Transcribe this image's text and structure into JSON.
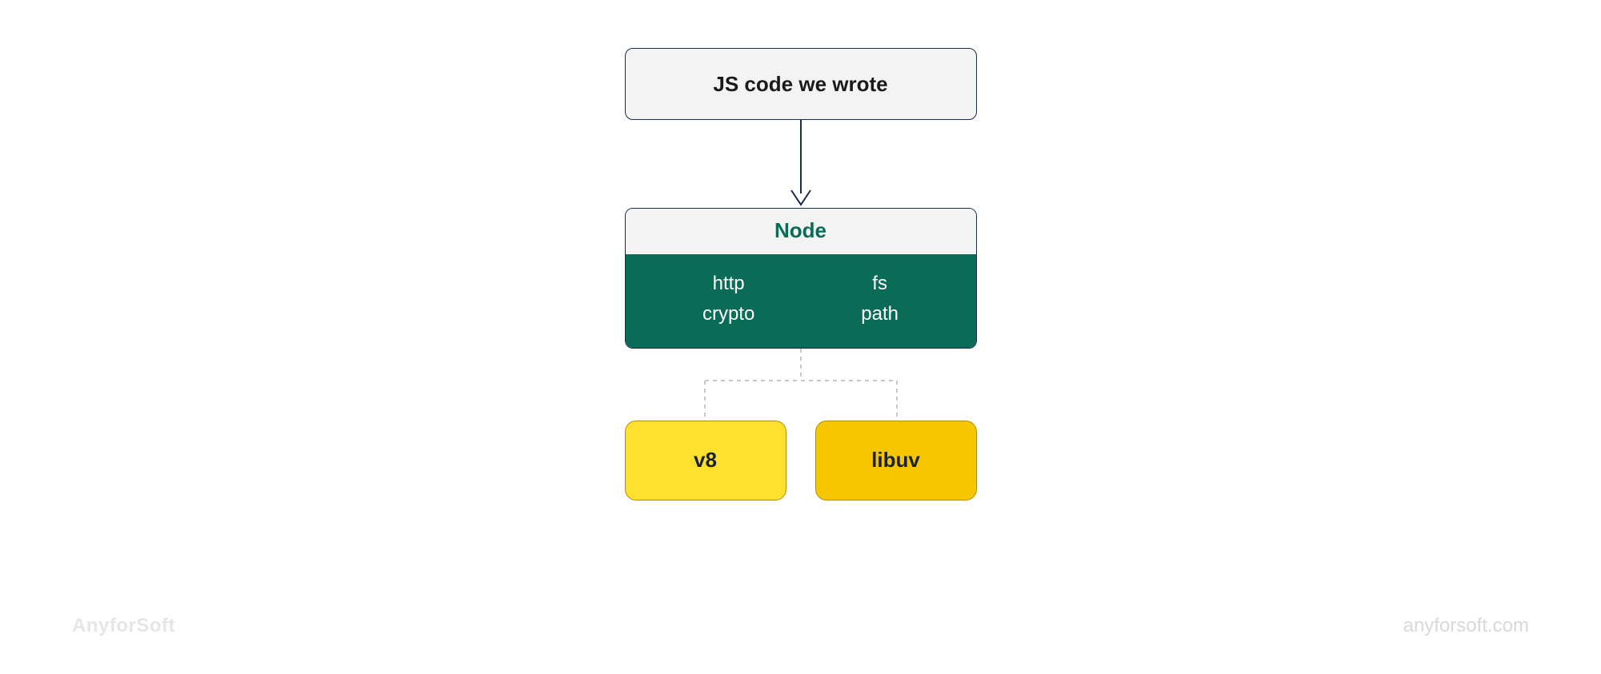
{
  "diagram": {
    "top_box": "JS code we wrote",
    "node_header": "Node",
    "node_modules_col1": [
      "http",
      "crypto"
    ],
    "node_modules_col2": [
      "fs",
      "path"
    ],
    "deps": {
      "left": "v8",
      "right": "libuv"
    }
  },
  "footer": {
    "left": "AnyforSoft",
    "right": "anyforsoft.com"
  },
  "colors": {
    "box_border": "#1a2b4c",
    "box_bg": "#f3f3f3",
    "node_green": "#0a6b56",
    "yellow_v8": "#ffe02e",
    "yellow_libuv": "#f6c700",
    "footer_gray": "#e6e6e6"
  }
}
